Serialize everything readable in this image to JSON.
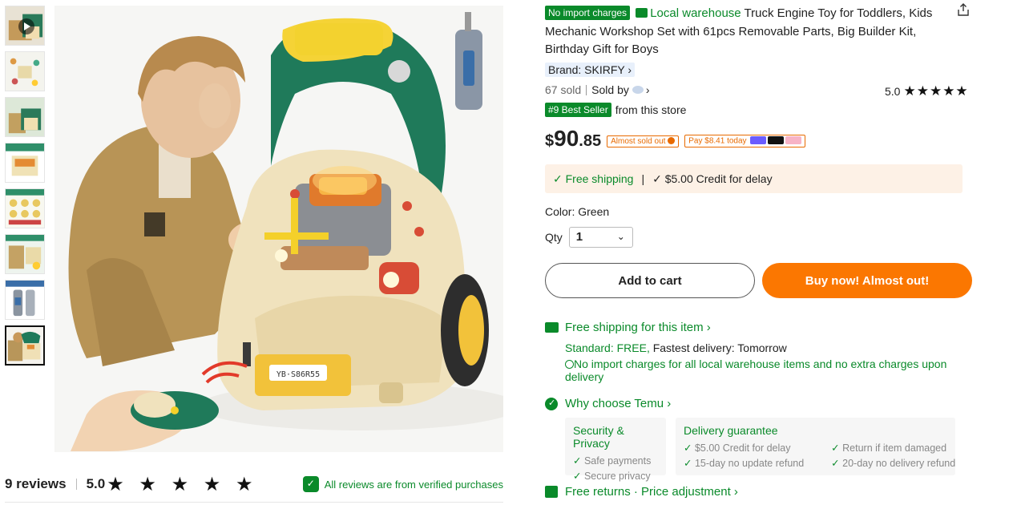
{
  "gallery": {
    "thumbnail_count": 8,
    "active_index": 7
  },
  "reviews": {
    "count_label": "9 reviews",
    "score": "5.0",
    "stars": "★ ★ ★ ★ ★",
    "verified_text": "All reviews are from verified purchases"
  },
  "product": {
    "badge_no_import": "No import charges",
    "local_warehouse": "Local warehouse",
    "title": "Truck Engine Toy for Toddlers, Kids Mechanic Workshop Set with 61pcs Removable Parts, Big Builder Kit, Birthday Gift for Boys",
    "brand": "Brand: SKIRFY ›",
    "sold": "67 sold",
    "sold_by": "Sold by",
    "sold_by_chevron": "›",
    "rating": "5.0",
    "rating_stars": "★★★★★",
    "best_seller_badge": "#9 Best Seller",
    "best_seller_suffix": "from this store"
  },
  "price": {
    "currency": "$",
    "integer": "90",
    "decimal": ".85",
    "almost_sold_out": "Almost sold out",
    "pay_today": "Pay $8.41 today"
  },
  "shipping_banner": {
    "free_shipping": "✓ Free shipping",
    "divider": "|",
    "credit": "✓ $5.00 Credit for delay"
  },
  "options": {
    "color_label": "Color: Green",
    "qty_label": "Qty",
    "qty_value": "1",
    "qty_chevron": "⌄"
  },
  "buttons": {
    "add_to_cart": "Add to cart",
    "buy_now": "Buy now! Almost out!"
  },
  "ship_section": {
    "heading": "Free shipping for this item ›",
    "standard_label": "Standard: FREE,",
    "fastest": " Fastest delivery: Tomorrow",
    "no_import": "No import charges for all local warehouse items and no extra charges upon delivery"
  },
  "why": {
    "heading": "Why choose Temu ›",
    "security_title": "Security & Privacy",
    "security_items": [
      "Safe payments",
      "Secure privacy"
    ],
    "delivery_title": "Delivery guarantee",
    "delivery_col1": [
      "$5.00 Credit for delay",
      "15-day no update refund"
    ],
    "delivery_col2": [
      "Return if item damaged",
      "20-day no delivery refund"
    ]
  },
  "returns": {
    "label": "Free returns · Price adjustment ›"
  },
  "colors": {
    "green": "#0a8a2a",
    "orange": "#fb7701"
  }
}
